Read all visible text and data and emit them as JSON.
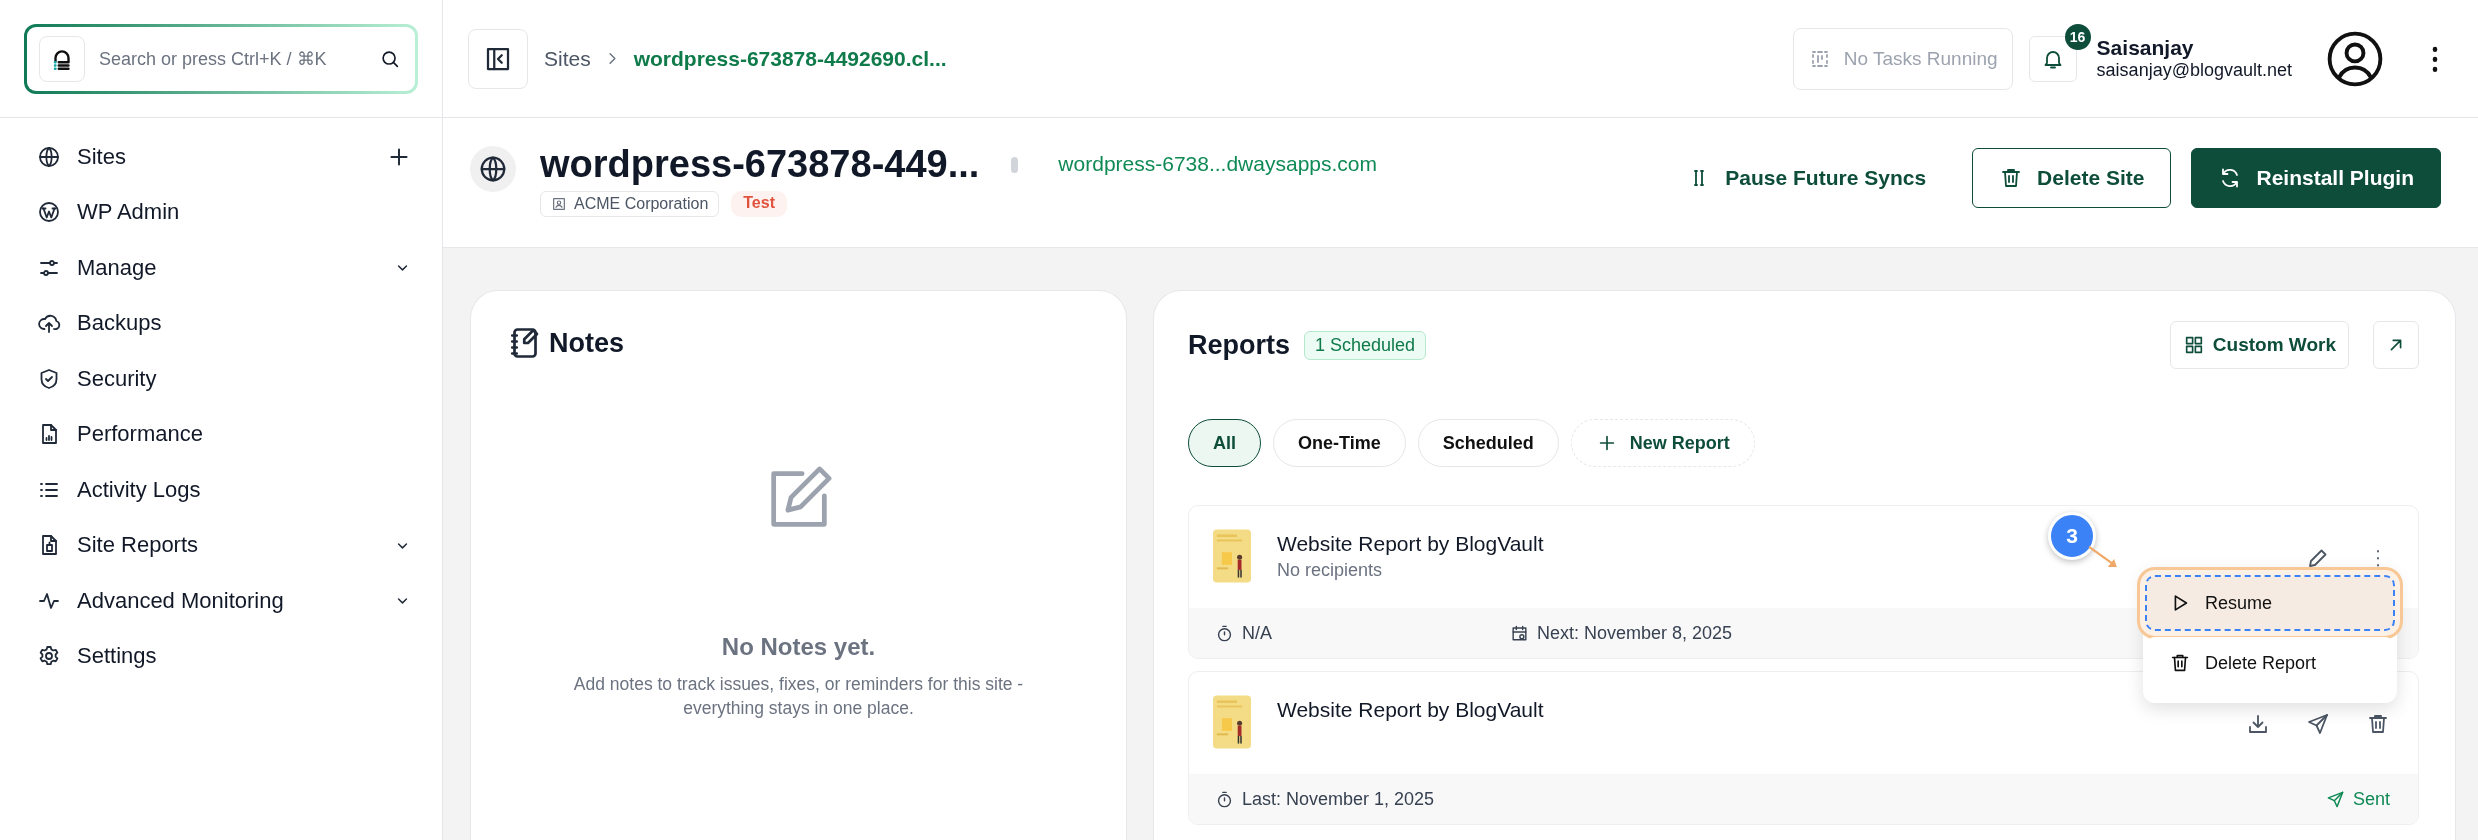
{
  "search": {
    "placeholder": "Search or press Ctrl+K / ⌘K"
  },
  "breadcrumb": [
    {
      "label": "Sites",
      "current": false
    },
    {
      "label": "wordpress-673878-4492690.cl...",
      "current": true
    }
  ],
  "tasks": {
    "label": "No Tasks Running",
    "disabled": true
  },
  "notifications": {
    "count": "16"
  },
  "user": {
    "name": "Saisanjay",
    "email": "saisanjay@blogvault.net"
  },
  "sidebar": {
    "items": [
      {
        "label": "Sites",
        "kind": "addable"
      },
      {
        "label": "WP Admin",
        "kind": "link"
      },
      {
        "label": "Manage",
        "kind": "expandable"
      },
      {
        "label": "Backups",
        "kind": "link"
      },
      {
        "label": "Security",
        "kind": "link"
      },
      {
        "label": "Performance",
        "kind": "link"
      },
      {
        "label": "Activity Logs",
        "kind": "link"
      },
      {
        "label": "Site Reports",
        "kind": "expandable"
      },
      {
        "label": "Advanced Monitoring",
        "kind": "expandable"
      },
      {
        "label": "Settings",
        "kind": "link"
      }
    ]
  },
  "site": {
    "title": "wordpress-673878-449...",
    "client": "ACME Corporation",
    "tag": "Test",
    "url": "wordpress-6738...dwaysapps.com"
  },
  "actions": [
    {
      "label": "Pause Future Syncs",
      "kind": "text"
    },
    {
      "label": "Delete Site",
      "kind": "outline"
    },
    {
      "label": "Reinstall Plugin",
      "kind": "primary"
    }
  ],
  "notes": {
    "title": "Notes",
    "empty_title": "No Notes yet.",
    "empty_text": "Add notes to track issues, fixes, or reminders for this site - everything stays in one place."
  },
  "reports": {
    "title": "Reports",
    "badge": "1 Scheduled",
    "custom_work": "Custom Work",
    "filters": [
      {
        "label": "All",
        "selected": true
      },
      {
        "label": "One-Time",
        "selected": false
      },
      {
        "label": "Scheduled",
        "selected": false
      }
    ],
    "new_report": "New Report",
    "items": [
      {
        "kind": "scheduled",
        "title": "Website Report by BlogVault",
        "subtitle": "No recipients",
        "meta": [
          "N/A",
          "Next: November 8, 2025"
        ]
      },
      {
        "kind": "sent",
        "title": "Website Report by BlogVault",
        "meta": [
          "Last: November 1, 2025"
        ],
        "status": "Sent"
      }
    ]
  },
  "menu": {
    "items": [
      {
        "label": "Resume",
        "highlighted": true
      },
      {
        "label": "Delete Report",
        "highlighted": false
      }
    ]
  },
  "tour": {
    "step": "3"
  }
}
